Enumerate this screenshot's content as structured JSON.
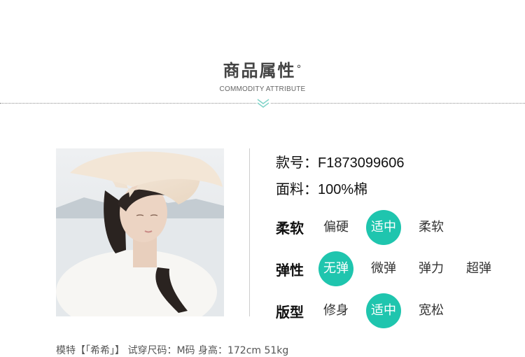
{
  "header": {
    "title": "商品属性",
    "title_mark": "°",
    "subtitle": "COMMODITY ATTRIBUTE"
  },
  "specs": {
    "style_no_label": "款号：",
    "style_no_value": "F1873099606",
    "material_label": "面料：",
    "material_value": "100%棉"
  },
  "attributes": [
    {
      "label": "柔软",
      "options": [
        "偏硬",
        "适中",
        "柔软"
      ],
      "selected": "适中"
    },
    {
      "label": "弹性",
      "options": [
        "无弹",
        "微弹",
        "弹力",
        "超弹"
      ],
      "selected": "无弹"
    },
    {
      "label": "版型",
      "options": [
        "修身",
        "适中",
        "宽松"
      ],
      "selected": "适中"
    }
  ],
  "caption": "模特【「希希」】 试穿尺码：M码 身高：172cm 51kg",
  "colors": {
    "accent": "#1fc5ae",
    "dotted_line": "#8a8a8a",
    "chevron": "#7fd3c8"
  }
}
